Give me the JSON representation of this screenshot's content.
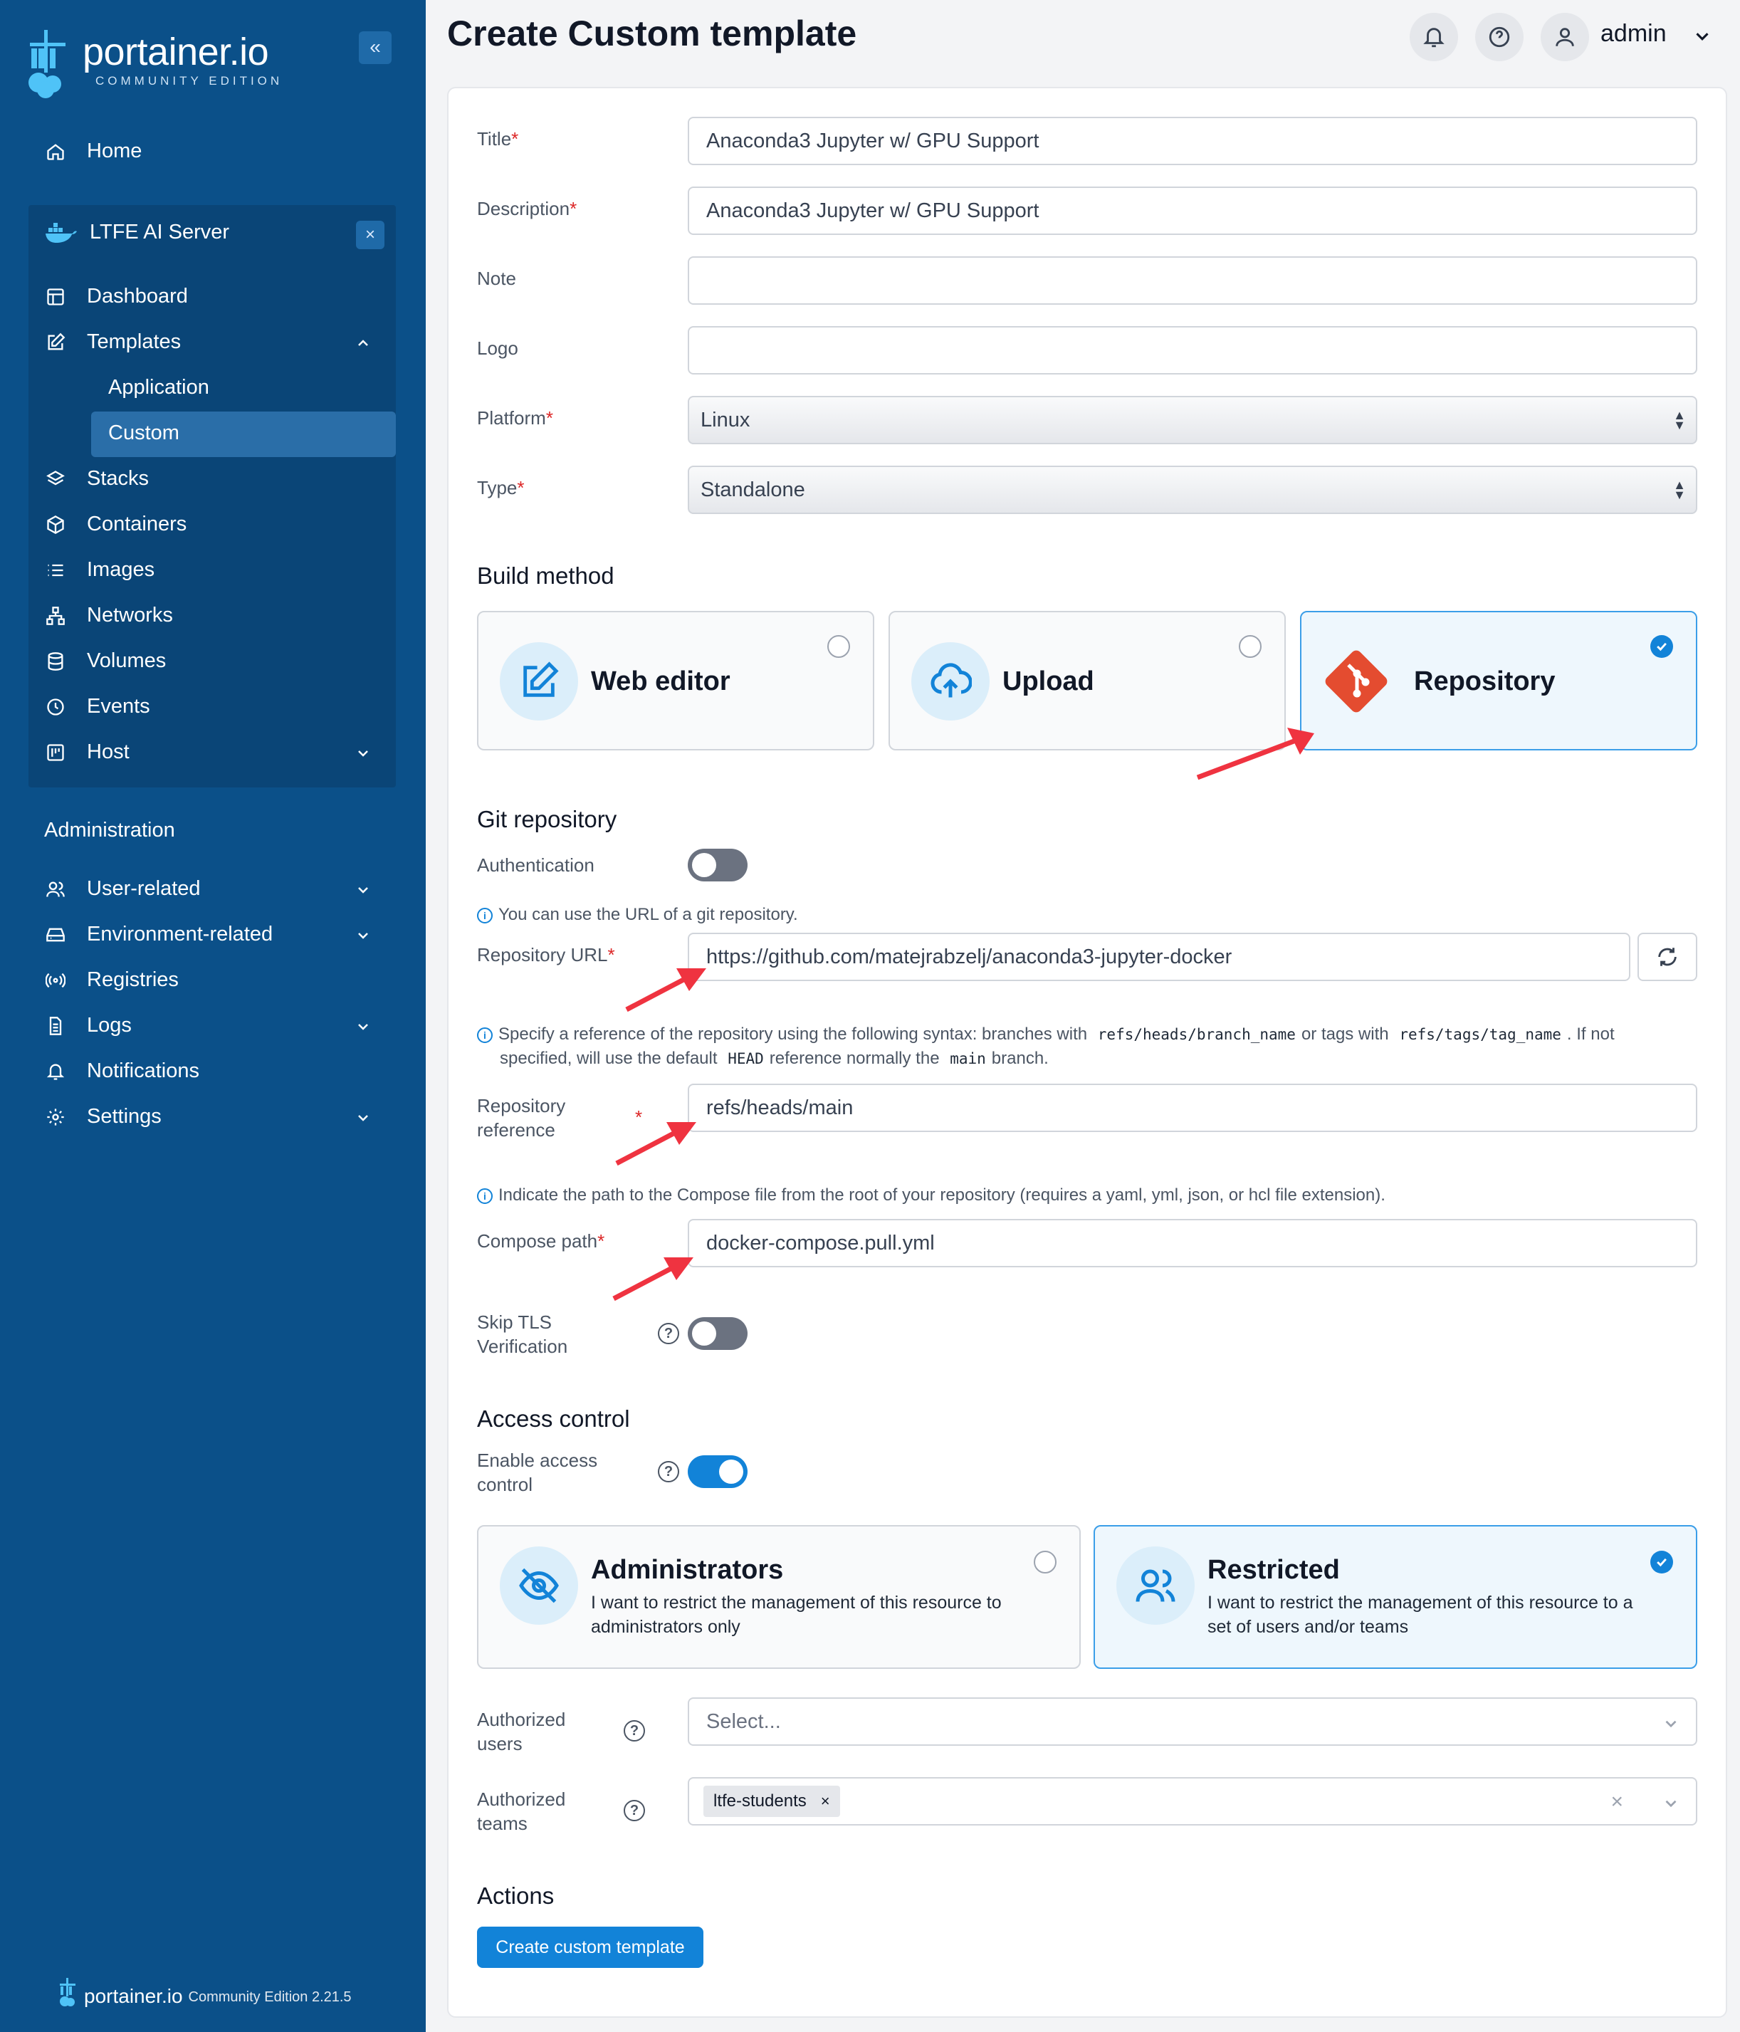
{
  "brand": {
    "name": "portainer.io",
    "edition": "COMMUNITY EDITION",
    "footer_name": "portainer.io",
    "footer_edition": "Community Edition 2.21.5"
  },
  "sidebar": {
    "home": "Home",
    "environment": {
      "name": "LTFE AI Server",
      "items": {
        "dashboard": "Dashboard",
        "templates": "Templates",
        "application": "Application",
        "custom": "Custom",
        "stacks": "Stacks",
        "containers": "Containers",
        "images": "Images",
        "networks": "Networks",
        "volumes": "Volumes",
        "events": "Events",
        "host": "Host"
      }
    },
    "administration": {
      "title": "Administration",
      "items": {
        "user_related": "User-related",
        "environment_related": "Environment-related",
        "registries": "Registries",
        "logs": "Logs",
        "notifications": "Notifications",
        "settings": "Settings"
      }
    }
  },
  "header": {
    "title": "Create Custom template",
    "user": "admin"
  },
  "form": {
    "title": {
      "label": "Title",
      "value": "Anaconda3 Jupyter w/ GPU Support"
    },
    "description": {
      "label": "Description",
      "value": "Anaconda3 Jupyter w/ GPU Support"
    },
    "note": {
      "label": "Note",
      "value": ""
    },
    "logo": {
      "label": "Logo",
      "value": ""
    },
    "platform": {
      "label": "Platform",
      "value": "Linux"
    },
    "type": {
      "label": "Type",
      "value": "Standalone"
    }
  },
  "build_method": {
    "title": "Build method",
    "options": {
      "web_editor": "Web editor",
      "upload": "Upload",
      "repository": "Repository"
    },
    "selected": "repository"
  },
  "git": {
    "title": "Git repository",
    "authentication_label": "Authentication",
    "url_info": "You can use the URL of a git repository.",
    "url_label": "Repository URL",
    "url_value": "https://github.com/matejrabzelj/anaconda3-jupyter-docker",
    "ref_info_1": "Specify a reference of the repository using the following syntax: branches with",
    "ref_code_1": "refs/heads/branch_name",
    "ref_info_2": "or tags with",
    "ref_code_2": "refs/tags/tag_name",
    "ref_info_3": ". If not",
    "ref_info_4": "specified, will use the default",
    "ref_code_3": "HEAD",
    "ref_info_5": "reference normally the",
    "ref_code_4": "main",
    "ref_info_6": "branch.",
    "ref_label_1": "Repository",
    "ref_label_2": "reference",
    "ref_value": "refs/heads/main",
    "compose_info": "Indicate the path to the Compose file from the root of your repository (requires a yaml, yml, json, or hcl file extension).",
    "compose_label": "Compose path",
    "compose_value": "docker-compose.pull.yml",
    "tls_label_1": "Skip TLS",
    "tls_label_2": "Verification"
  },
  "access": {
    "title": "Access control",
    "enable_label_1": "Enable access",
    "enable_label_2": "control",
    "admins_title": "Administrators",
    "admins_desc_1": "I want to restrict the management of this resource to",
    "admins_desc_2": "administrators only",
    "restricted_title": "Restricted",
    "restricted_desc_1": "I want to restrict the management of this resource to a",
    "restricted_desc_2": "set of users and/or teams",
    "users_label_1": "Authorized",
    "users_label_2": "users",
    "users_placeholder": "Select...",
    "teams_label_1": "Authorized",
    "teams_label_2": "teams",
    "teams_selected": "ltfe-students"
  },
  "actions": {
    "title": "Actions",
    "create_button": "Create custom template"
  },
  "colors": {
    "sidebar": "#0b5089",
    "accent": "#1283d8",
    "annotation_arrow": "#ef3340"
  }
}
